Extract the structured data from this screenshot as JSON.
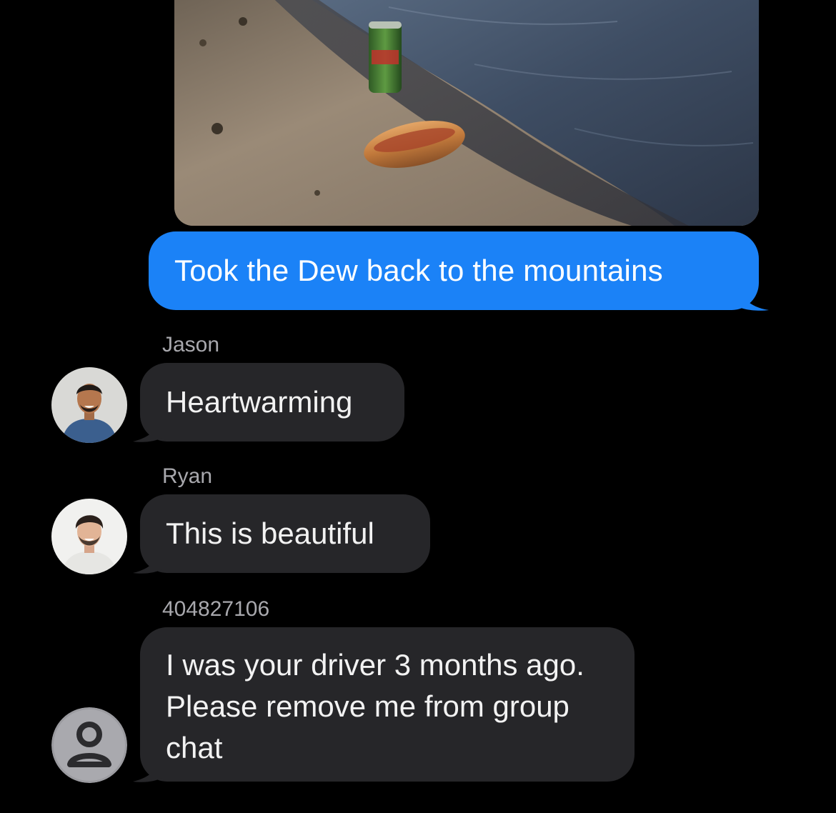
{
  "conversation": {
    "sent_photo": {
      "alt_icon": "photo-attachment"
    },
    "sent_message": "Took the Dew back to the mountains",
    "messages": [
      {
        "sender": "Jason",
        "text": "Heartwarming",
        "avatar_icon": "contact-photo"
      },
      {
        "sender": "Ryan",
        "text": "This is beautiful",
        "avatar_icon": "contact-photo"
      },
      {
        "sender": "404827106",
        "text": "I was your driver 3 months ago. Please remove me from group chat",
        "avatar_icon": "unknown-contact-icon"
      }
    ]
  },
  "colors": {
    "background": "#000000",
    "sent_bubble": "#1b82f7",
    "received_bubble": "#262629",
    "sender_name": "#a8a8ad"
  }
}
